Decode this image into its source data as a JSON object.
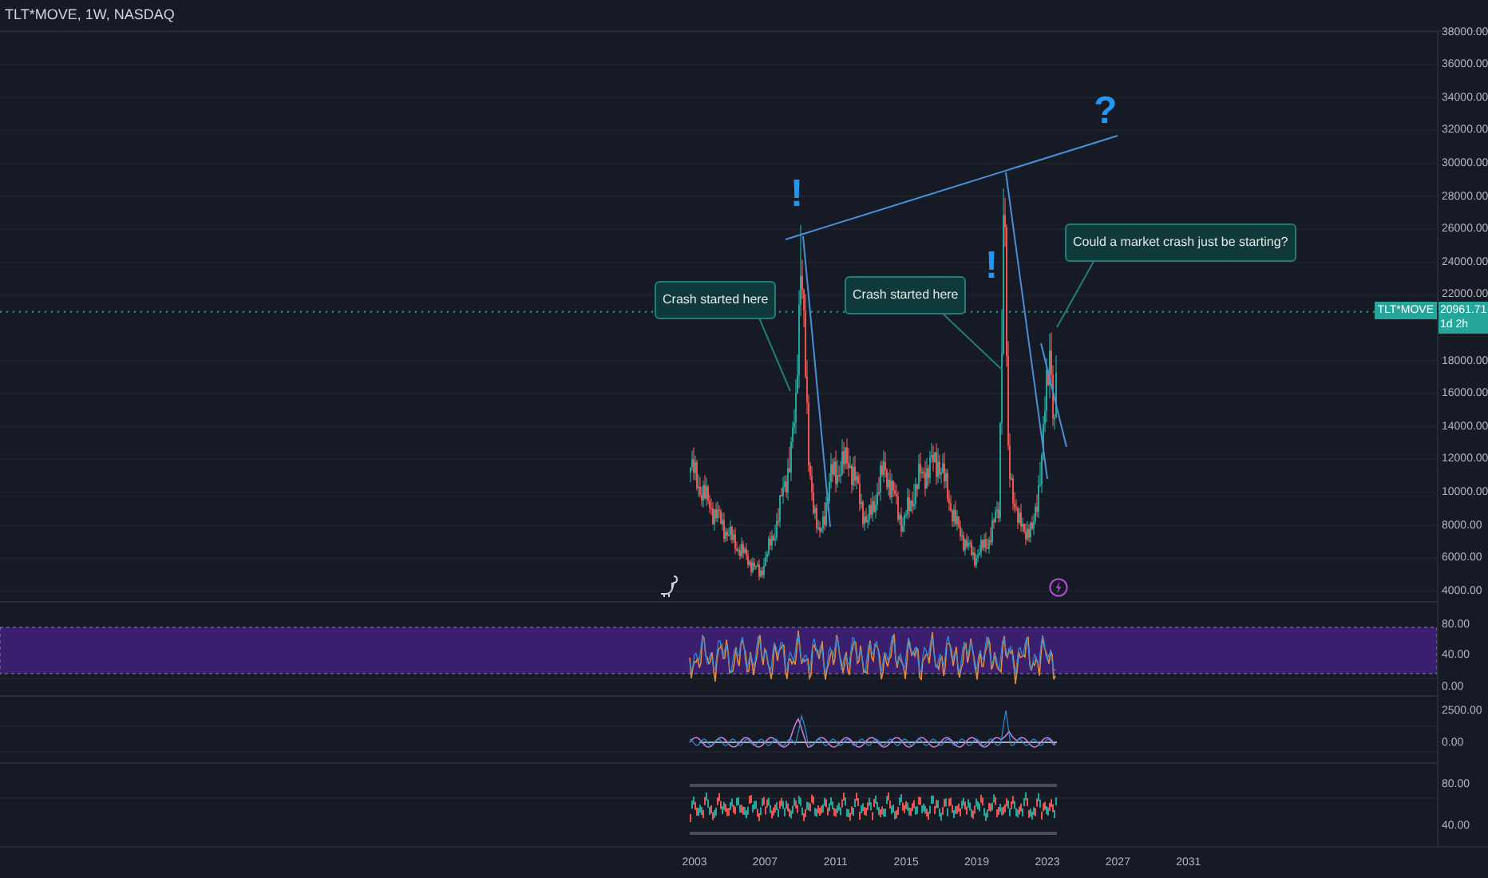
{
  "header": {
    "symbol_line": "TLT*MOVE, 1W, NASDAQ"
  },
  "price_axis": {
    "labels": [
      "38000.00",
      "36000.00",
      "34000.00",
      "32000.00",
      "30000.00",
      "28000.00",
      "26000.00",
      "24000.00",
      "22000.00",
      "18000.00",
      "16000.00",
      "14000.00",
      "12000.00",
      "10000.00",
      "8000.00",
      "6000.00",
      "4000.00"
    ]
  },
  "last_price": {
    "symbol": "TLT*MOVE",
    "value": "20961.71",
    "countdown": "1d 2h"
  },
  "annotations": [
    {
      "kind": "callout",
      "text": "Crash started here"
    },
    {
      "kind": "callout",
      "text": "Crash started here"
    },
    {
      "kind": "callout",
      "text": "Could a market crash just be starting?"
    },
    {
      "kind": "mark",
      "text": "!"
    },
    {
      "kind": "mark",
      "text": "!"
    },
    {
      "kind": "mark",
      "text": "?"
    }
  ],
  "panes": [
    {
      "axis_labels": [
        "80.00",
        "40.00",
        "0.00"
      ]
    },
    {
      "axis_labels": [
        "2500.00",
        "0.00"
      ]
    },
    {
      "axis_labels": [
        "80.00",
        "40.00"
      ]
    }
  ],
  "time_axis": {
    "labels": [
      "2003",
      "2007",
      "2011",
      "2015",
      "2019",
      "2023",
      "2027",
      "2031"
    ]
  }
}
